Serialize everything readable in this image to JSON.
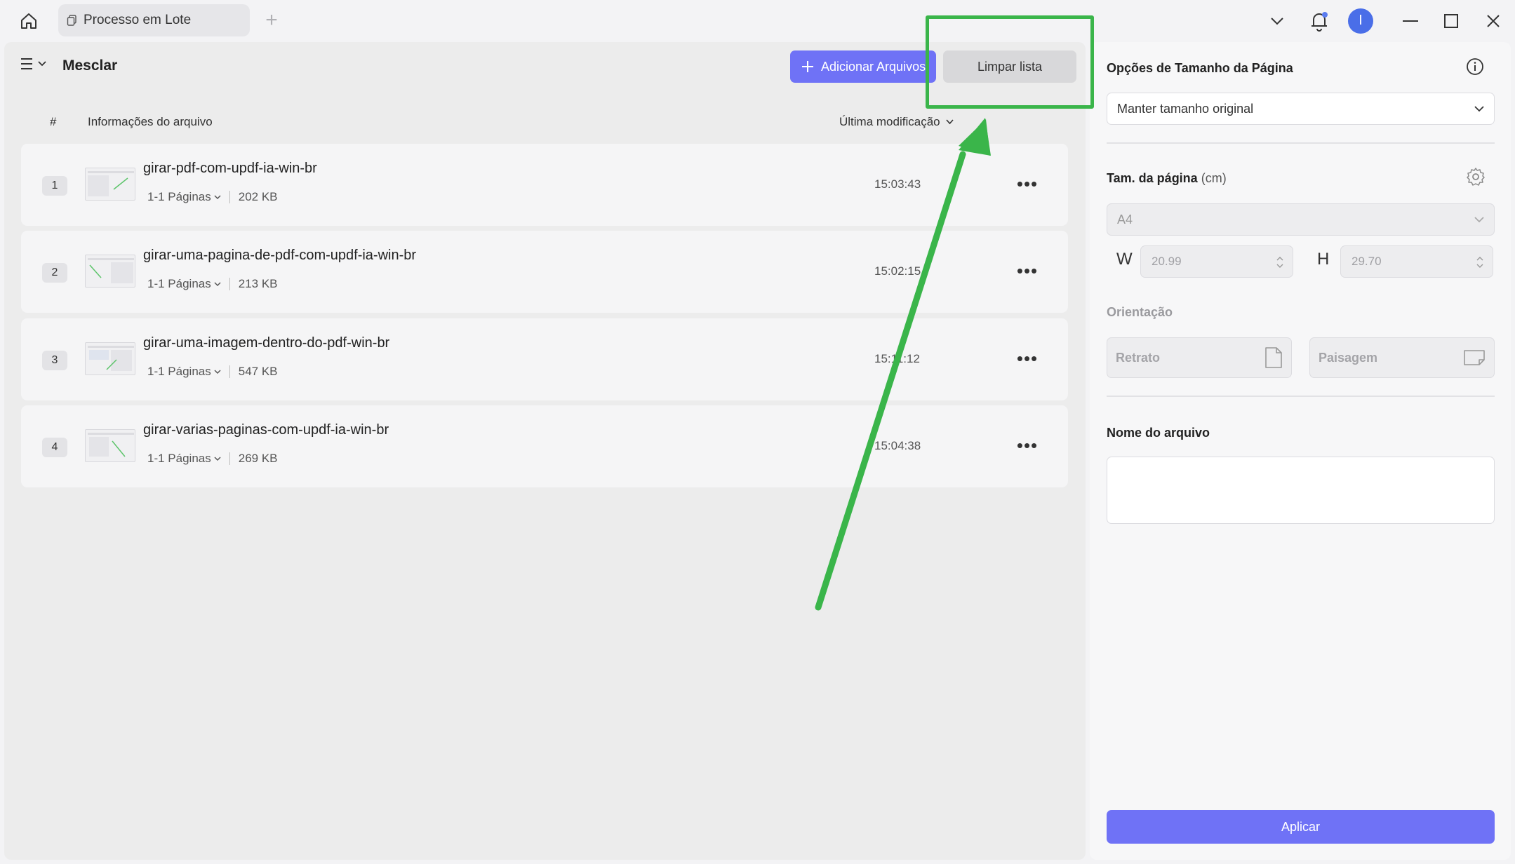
{
  "titlebar": {
    "tab_label": "Processo em Lote",
    "avatar_initial": "I"
  },
  "toolbar": {
    "mode_title": "Mesclar",
    "add_files_label": "Adicionar Arquivos",
    "clear_list_label": "Limpar lista"
  },
  "table": {
    "col_number": "#",
    "col_info": "Informações do arquivo",
    "col_modified": "Última modificação",
    "rows": [
      {
        "num": "1",
        "name": "girar-pdf-com-updf-ia-win-br",
        "pages": "1-1 Páginas",
        "size": "202 KB",
        "time": "15:03:43"
      },
      {
        "num": "2",
        "name": "girar-uma-pagina-de-pdf-com-updf-ia-win-br",
        "pages": "1-1 Páginas",
        "size": "213 KB",
        "time": "15:02:15"
      },
      {
        "num": "3",
        "name": "girar-uma-imagem-dentro-do-pdf-win-br",
        "pages": "1-1 Páginas",
        "size": "547 KB",
        "time": "15:11:12"
      },
      {
        "num": "4",
        "name": "girar-varias-paginas-com-updf-ia-win-br",
        "pages": "1-1 Páginas",
        "size": "269 KB",
        "time": "15:04:38"
      }
    ]
  },
  "panel": {
    "page_size_options_title": "Opções de Tamanho da Página",
    "size_mode_selected": "Manter tamanho original",
    "page_size_label": "Tam. da página",
    "page_size_unit": "(cm)",
    "page_format_selected": "A4",
    "width_letter": "W",
    "width_value": "20.99",
    "height_letter": "H",
    "height_value": "29.70",
    "orientation_label": "Orientação",
    "portrait_label": "Retrato",
    "landscape_label": "Paisagem",
    "file_name_label": "Nome do arquivo",
    "file_name_value": "",
    "apply_label": "Aplicar"
  },
  "colors": {
    "accent": "#6f72f6",
    "highlight": "#3ab54a",
    "avatar": "#4a6ee8"
  }
}
